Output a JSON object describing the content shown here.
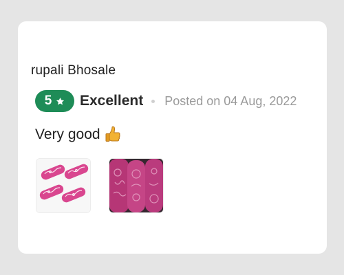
{
  "review": {
    "reviewer_name": "rupali Bhosale",
    "rating_value": "5",
    "rating_label": "Excellent",
    "posted": "Posted on 04 Aug, 2022",
    "comment": "Very good",
    "photos": [
      {
        "name": "review-photo-1"
      },
      {
        "name": "review-photo-2"
      }
    ]
  },
  "colors": {
    "badge_green": "#1e8c57",
    "product_pink": "#d9468f"
  },
  "icons": {
    "star": "star-icon",
    "thumb": "thumbs-up-icon"
  }
}
